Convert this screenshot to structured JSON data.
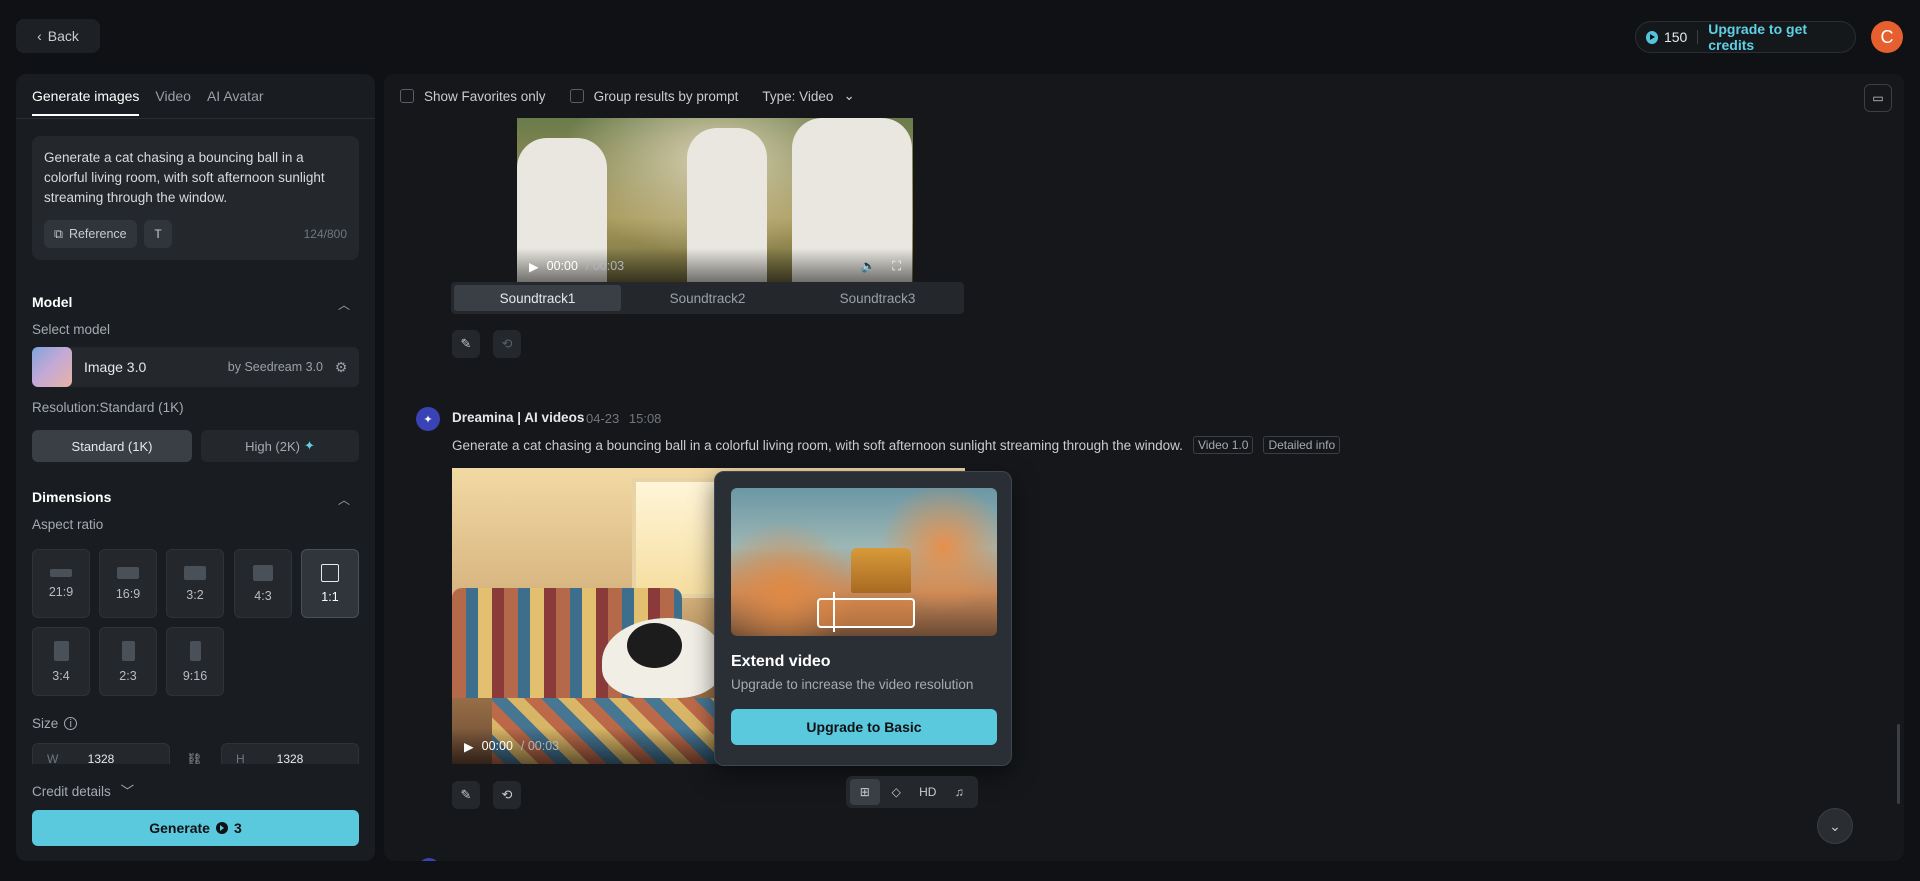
{
  "topbar": {
    "back_label": "Back",
    "credits": "150",
    "upgrade_label": "Upgrade to get credits",
    "avatar_initial": "C"
  },
  "left": {
    "tabs": [
      {
        "label": "Generate images",
        "active": true
      },
      {
        "label": "Video",
        "active": false
      },
      {
        "label": "AI Avatar",
        "active": false
      }
    ],
    "prompt": "Generate a cat chasing a bouncing ball in a colorful living room, with soft afternoon sunlight streaming through the window.",
    "reference_label": "Reference",
    "char_count": "124/800",
    "model_section": "Model",
    "select_model_label": "Select model",
    "model_name": "Image 3.0",
    "model_by": "by Seedream 3.0",
    "resolution_label": "Resolution:Standard (1K)",
    "res_standard": "Standard (1K)",
    "res_high": "High (2K)",
    "dimensions_section": "Dimensions",
    "aspect_ratio_label": "Aspect ratio",
    "ratios": [
      "21:9",
      "16:9",
      "3:2",
      "4:3",
      "1:1",
      "3:4",
      "2:3",
      "9:16"
    ],
    "selected_ratio": "1:1",
    "size_label": "Size",
    "width_label": "W",
    "width_value": "1328",
    "height_label": "H",
    "height_value": "1328",
    "credit_details": "Credit details",
    "generate_label": "Generate",
    "generate_cost": "3"
  },
  "right": {
    "show_favorites": "Show Favorites only",
    "group_results": "Group results by prompt",
    "type_filter": "Type: Video",
    "video1": {
      "time_current": "00:00",
      "time_total": "/ 00:03",
      "soundtracks": [
        "Soundtrack1",
        "Soundtrack2",
        "Soundtrack3"
      ]
    },
    "post": {
      "author": "Dreamina | AI videos",
      "date": "04-23",
      "time": "15:08",
      "prompt": "Generate a cat chasing a bouncing ball in a colorful living room, with soft afternoon sunlight streaming through the window.",
      "tag_model": "Video 1.0",
      "tag_info": "Detailed info",
      "time_current": "00:00",
      "time_total": "/ 00:03"
    },
    "popover": {
      "title": "Extend video",
      "subtitle": "Upgrade to increase the video resolution",
      "button": "Upgrade to Basic"
    },
    "tools": {
      "hd_label": "HD"
    }
  },
  "colors": {
    "accent": "#5ac8dd",
    "avatar": "#e5602e",
    "background": "#0f1114"
  }
}
